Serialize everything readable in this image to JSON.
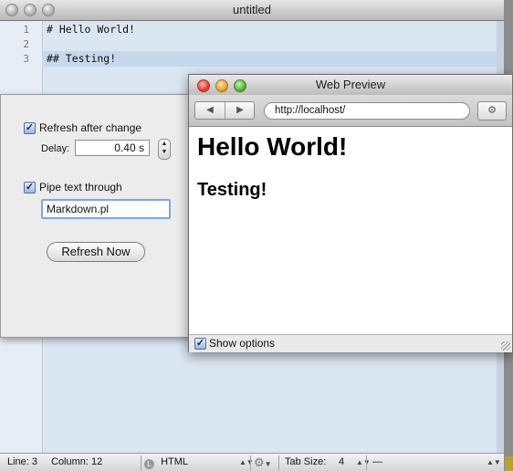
{
  "editor": {
    "title": "untitled",
    "line_numbers": [
      "1",
      "2",
      "3"
    ],
    "lines": [
      "# Hello World!",
      "",
      "## Testing!"
    ]
  },
  "status_bar": {
    "line": "Line: 3",
    "column": "Column: 12",
    "language": "HTML",
    "tab_size_label": "Tab Size:",
    "tab_size_value": "4",
    "symbol": "—"
  },
  "options": {
    "refresh_after_change_label": "Refresh after change",
    "refresh_after_change_checked": true,
    "delay_label": "Delay:",
    "delay_value": "0.40 s",
    "pipe_text_label": "Pipe text through",
    "pipe_text_checked": true,
    "pipe_text_value": "Markdown.pl",
    "refresh_now_label": "Refresh Now"
  },
  "preview": {
    "title": "Web Preview",
    "url": "http://localhost/",
    "heading1": "Hello World!",
    "heading2": "Testing!",
    "show_options_label": "Show options",
    "show_options_checked": true
  },
  "colors": {
    "close": "#e0443e",
    "minimize": "#e6a23a",
    "zoom": "#58b63a",
    "accent": "#7fa6e1"
  }
}
